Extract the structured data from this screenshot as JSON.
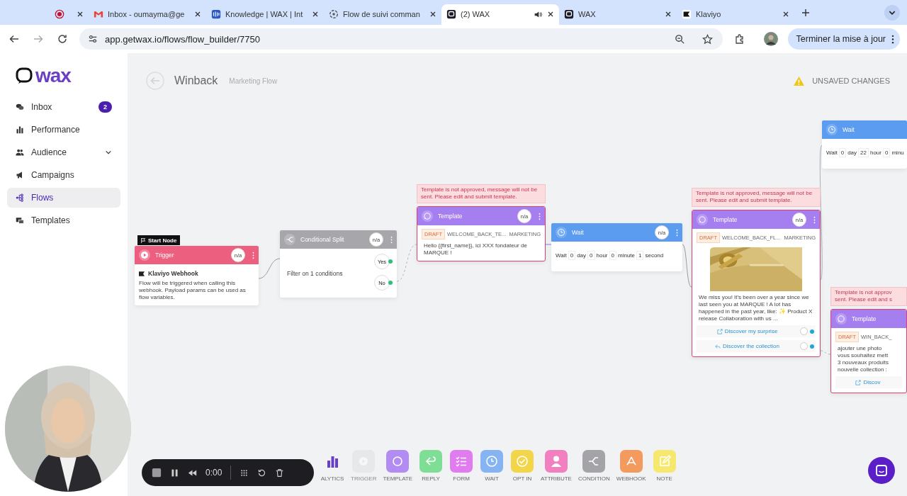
{
  "browser": {
    "tabs": [
      {
        "selected": false,
        "audio": false
      },
      {
        "title": "Inbox - oumayma@ge",
        "selected": false,
        "audio": false
      },
      {
        "title": "Knowledge | WAX | Int",
        "selected": false,
        "audio": false
      },
      {
        "title": "Flow de suivi comman",
        "selected": false,
        "audio": false
      },
      {
        "title": "(2) WAX",
        "selected": true,
        "audio": true
      },
      {
        "title": "WAX",
        "selected": false,
        "audio": false
      },
      {
        "title": "Klaviyo",
        "selected": false,
        "audio": false
      }
    ],
    "url": "app.getwax.io/flows/flow_builder/7750",
    "update_button": "Terminer la mise à jour"
  },
  "sidebar": {
    "logo": "wax",
    "items": [
      {
        "label": "Inbox",
        "badge": "2",
        "selected": false,
        "expandable": false
      },
      {
        "label": "Performance",
        "selected": false,
        "expandable": false
      },
      {
        "label": "Audience",
        "selected": false,
        "expandable": true
      },
      {
        "label": "Campaigns",
        "selected": false,
        "expandable": false
      },
      {
        "label": "Flows",
        "selected": true,
        "expandable": false
      },
      {
        "label": "Templates",
        "selected": false,
        "expandable": false
      }
    ]
  },
  "header": {
    "title": "Winback",
    "subtitle": "Marketing Flow",
    "status": "UNSAVED CHANGES"
  },
  "nodes": [
    {
      "kind": "trigger",
      "badge": "Start Node",
      "title": "Trigger",
      "stat": "n/a",
      "source": "Klaviyo Webhook",
      "text": "Flow will be triggered when calling this webhook. Payload params can be used as flow variables."
    },
    {
      "kind": "condition",
      "title": "Conditional Split",
      "stat": "n/a",
      "text": "Filter on 1 conditions",
      "outputs": [
        "Yes",
        "No"
      ]
    },
    {
      "kind": "template",
      "warning": "Template is not approved, message will not be sent. Please edit and submit template.",
      "title": "Template",
      "stat": "n/a",
      "status": "DRAFT",
      "name": "WELCOME_BACK_TE...",
      "category": "MARKETING",
      "text": "Hello {{first_name}}, ici XXX fondateur de MARQUE !"
    },
    {
      "kind": "wait",
      "title": "Wait",
      "stat": "n/a",
      "label": "Wait",
      "durations": [
        {
          "value": "0",
          "unit": "day"
        },
        {
          "value": "0",
          "unit": "hour"
        },
        {
          "value": "0",
          "unit": "minute"
        },
        {
          "value": "1",
          "unit": "second"
        }
      ]
    },
    {
      "kind": "template",
      "warning": "Template is not approved, message will not be sent. Please edit and submit template.",
      "title": "Template",
      "stat": "n/a",
      "status": "DRAFT",
      "name": "WELCOME_BACK_FL...",
      "category": "MARKETING",
      "media": {
        "kind": "picture"
      },
      "text": "We miss you! It's been over a year since we last seen you at MARQUE ! A lot has happened in the past year, like: ✨ Product X release Collaboration with us ...",
      "buttons": [
        {
          "label": "Discover my surprise",
          "kind": "url"
        },
        {
          "label": "Discover the collection",
          "kind": "reply"
        }
      ]
    },
    {
      "kind": "wait",
      "title": "Wait",
      "label": "Wait",
      "durations": [
        {
          "value": "0",
          "unit": "day"
        },
        {
          "value": "22",
          "unit": "hour"
        },
        {
          "value": "0",
          "unit": "minu"
        }
      ]
    },
    {
      "kind": "template",
      "warning": "Template is not approv\nsent. Please edit and s",
      "title": "Template",
      "status": "DRAFT",
      "name": "WIN_BACK_",
      "text": "ajouter une photo\nvous souhaitez mett\n3 nouveaux produits\nnouvelle collection :",
      "buttons": [
        {
          "label": "Discov",
          "kind": "url"
        }
      ]
    }
  ],
  "toolbar": [
    {
      "label": "ALYTICS",
      "color": "#6a3fc8",
      "disabled": false
    },
    {
      "label": "TRIGGER",
      "color": "#dcdcde",
      "disabled": true
    },
    {
      "label": "TEMPLATE",
      "color": "#b28cf2",
      "disabled": false
    },
    {
      "label": "REPLY",
      "color": "#7fde95",
      "disabled": false
    },
    {
      "label": "FORM",
      "color": "#e07cf0",
      "disabled": false
    },
    {
      "label": "WAIT",
      "color": "#86b4f2",
      "disabled": false
    },
    {
      "label": "OPT IN",
      "color": "#f3d54a",
      "disabled": false
    },
    {
      "label": "ATTRIBUTE",
      "color": "#f27fbf",
      "disabled": false
    },
    {
      "label": "CONDITION",
      "color": "#a4a4a8",
      "disabled": false
    },
    {
      "label": "WEBHOOK",
      "color": "#f39a5e",
      "disabled": false
    },
    {
      "label": "NOTE",
      "color": "#f6e86e",
      "disabled": false
    }
  ],
  "recorder": {
    "time": "0:00"
  }
}
